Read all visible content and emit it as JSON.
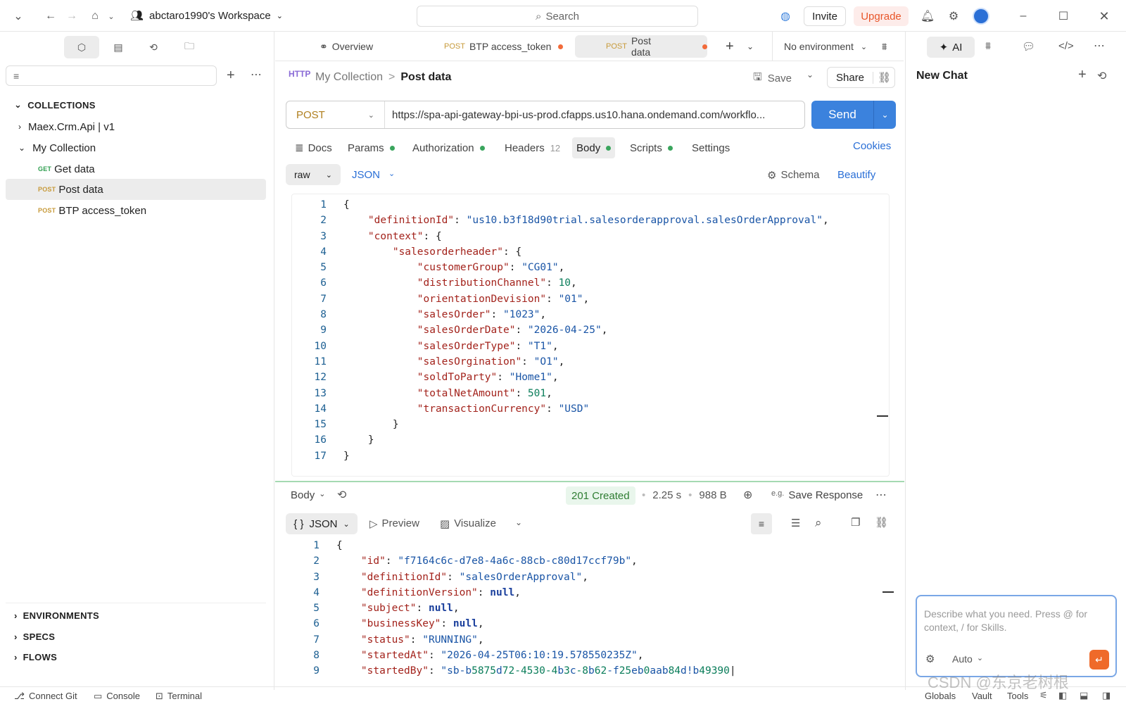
{
  "topbar": {
    "workspace": "abctaro1990's Workspace",
    "search_placeholder": "Search",
    "invite": "Invite",
    "upgrade": "Upgrade"
  },
  "sidebar": {
    "filter_placeholder": "",
    "collections_header": "COLLECTIONS",
    "tree": [
      {
        "label": "Maex.Crm.Api | v1"
      },
      {
        "label": "My Collection"
      },
      {
        "method": "GET",
        "label": "Get data"
      },
      {
        "method": "POST",
        "label": "Post data"
      },
      {
        "method": "POST",
        "label": "BTP access_token"
      }
    ],
    "sections": [
      "ENVIRONMENTS",
      "SPECS",
      "FLOWS"
    ]
  },
  "tabs": [
    {
      "label": "Overview"
    },
    {
      "method": "POST",
      "label": "BTP access_token"
    },
    {
      "method": "POST",
      "label": "Post data"
    }
  ],
  "environment": "No environment",
  "breadcrumb": {
    "collection": "My Collection",
    "sep": ">",
    "request": "Post data"
  },
  "actions": {
    "save": "Save",
    "share": "Share"
  },
  "request": {
    "method": "POST",
    "url": "https://spa-api-gateway-bpi-us-prod.cfapps.us10.hana.ondemand.com/workflo...",
    "send": "Send"
  },
  "req_tabs": [
    {
      "label": "Docs"
    },
    {
      "label": "Params"
    },
    {
      "label": "Authorization"
    },
    {
      "label": "Headers",
      "count": "12"
    },
    {
      "label": "Body"
    },
    {
      "label": "Scripts"
    },
    {
      "label": "Settings"
    }
  ],
  "cookies": "Cookies",
  "body_mode": {
    "raw": "raw",
    "json": "JSON",
    "schema": "Schema",
    "beautify": "Beautify"
  },
  "request_body_lines": [
    "{",
    "    \"definitionId\": \"us10.b3f18d90trial.salesorderapproval.salesOrderApproval\",",
    "    \"context\": {",
    "        \"salesorderheader\": {",
    "            \"customerGroup\": \"CG01\",",
    "            \"distributionChannel\": 10,",
    "            \"orientationDevision\": \"01\",",
    "            \"salesOrder\": \"1023\",",
    "            \"salesOrderDate\": \"2026-04-25\",",
    "            \"salesOrderType\": \"T1\",",
    "            \"salesOrgination\": \"O1\",",
    "            \"soldToParty\": \"Home1\",",
    "            \"totalNetAmount\": 501,",
    "            \"transactionCurrency\": \"USD\"",
    "        }",
    "    }",
    "}"
  ],
  "response": {
    "tab": "Body",
    "status": "201 Created",
    "time": "2.25 s",
    "size": "988 B",
    "save_response": "Save Response",
    "format": "JSON",
    "preview": "Preview",
    "visualize": "Visualize",
    "lines": [
      "{",
      "    \"id\": \"f7164c6c-d7e8-4a6c-88cb-c80d17ccf79b\",",
      "    \"definitionId\": \"salesOrderApproval\",",
      "    \"definitionVersion\": null,",
      "    \"subject\": null,",
      "    \"businessKey\": null,",
      "    \"status\": \"RUNNING\",",
      "    \"startedAt\": \"2026-04-25T06:10:19.578550235Z\",",
      "    \"startedBy\": \"sb-b5875d72-4530-4b3c-8b62-f25eb0aab84d!b49390|"
    ]
  },
  "right_panel": {
    "ai": "AI",
    "title": "New Chat",
    "prompt_placeholder": "Describe what you need. Press @ for context, / for Skills.",
    "mode": "Auto"
  },
  "statusbar": {
    "connect_git": "Connect Git",
    "console": "Console",
    "terminal": "Terminal",
    "globals": "Globals",
    "vault": "Vault",
    "tools": "Tools"
  },
  "watermark": "CSDN @东京老树根",
  "colors": {
    "send": "#3b82dd",
    "upgrade": "#e8562a",
    "status_ok": "#2e7d32",
    "post": "#c79a3a",
    "get": "#2e9e4f"
  }
}
